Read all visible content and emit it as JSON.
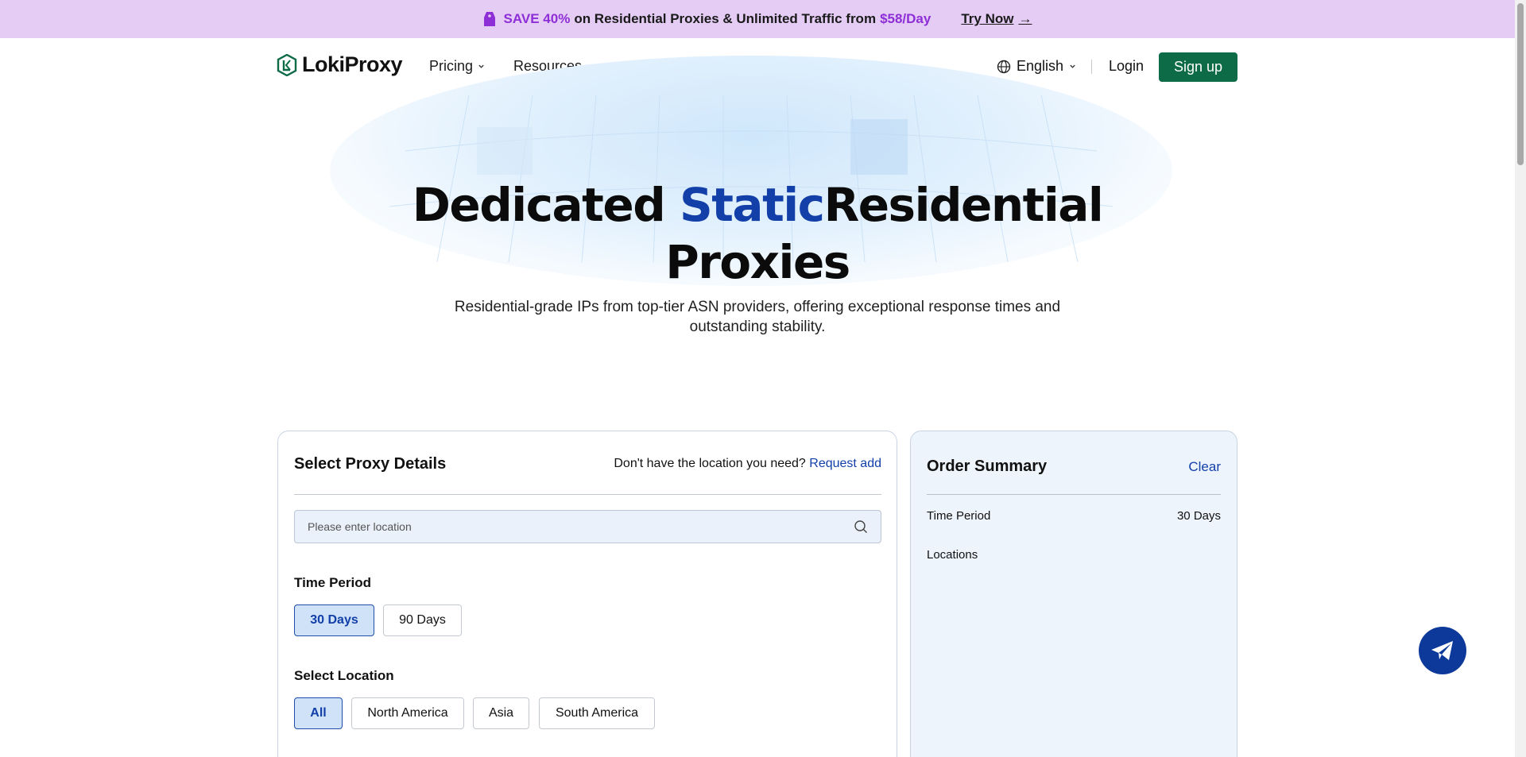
{
  "promo": {
    "save": "SAVE 40%",
    "text": "on Residential Proxies & Unlimited Traffic from",
    "price": "$58/Day",
    "cta": "Try Now",
    "cta_arrow": "→",
    "accent_color": "#8e2ed6",
    "background": "#e4ccf5"
  },
  "nav": {
    "brand": "LokiProxy",
    "pricing": "Pricing",
    "resources": "Resources",
    "language": "English",
    "login": "Login",
    "signup": "Sign up",
    "signup_color": "#0e6b48"
  },
  "hero": {
    "title_part1": "Dedicated",
    "title_accent": "Static",
    "title_part2": "Residential",
    "title_line2": "Proxies",
    "subtitle_line1": "Residential-grade IPs from top-tier ASN providers, offering exceptional response times and",
    "subtitle_line2": "outstanding stability.",
    "accent_color": "#123fa8"
  },
  "details": {
    "title": "Select Proxy Details",
    "request_prompt": "Don't have the location you need?",
    "request_link": "Request add",
    "search_placeholder": "Please enter location",
    "time_period_label": "Time Period",
    "time_options": [
      "30 Days",
      "90 Days"
    ],
    "time_selected": "30 Days",
    "location_label": "Select Location",
    "location_options": [
      "All",
      "North America",
      "Asia",
      "South America"
    ],
    "location_selected": "All"
  },
  "summary": {
    "title": "Order Summary",
    "clear": "Clear",
    "time_period_label": "Time Period",
    "time_period_value": "30 Days",
    "locations_label": "Locations"
  }
}
